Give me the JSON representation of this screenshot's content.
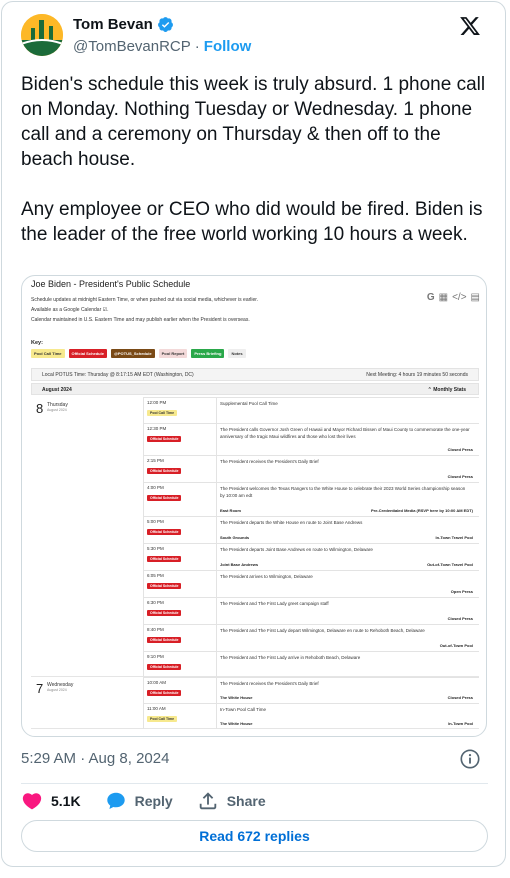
{
  "author": {
    "name": "Tom Bevan",
    "handle": "@TomBevanRCP",
    "follow_label": "Follow",
    "separator": "·",
    "verified_icon": "verified-badge-icon",
    "avatar_colors": {
      "bg": "#fdb827",
      "figure": "#1b6b3a"
    }
  },
  "tweet": {
    "text": "Biden's schedule this week is truly absurd. 1 phone call on Monday. Nothing Tuesday or Wednesday. 1 phone call and a ceremony on Thursday & then off to the beach house.\n\nAny employee or CEO who did would be fired. Biden is the leader of the free world working 10 hours a week.",
    "timestamp": "5:29 AM · Aug 8, 2024"
  },
  "media": {
    "title": "Joe Biden - President's Public Schedule",
    "notes": [
      "Schedule updates at midnight Eastern Time, or when pushed out via social media, whichever is earlier.",
      "Available as a Google Calendar ☑.",
      "Calendar maintained in U.S. Eastern Time and may publish earlier when the President is overseas."
    ],
    "tools": [
      "G",
      "▦",
      "</>",
      "▤"
    ],
    "key_label": "Key:",
    "legend": [
      {
        "label": "Pool Call Time",
        "cls": "b-pool"
      },
      {
        "label": "Official Schedule",
        "cls": "b-off"
      },
      {
        "label": "@POTUS_Schedule",
        "cls": "b-potus"
      },
      {
        "label": "Pool Report",
        "cls": "b-pr"
      },
      {
        "label": "Press Briefing",
        "cls": "b-press"
      },
      {
        "label": "Notes",
        "cls": "b-notes"
      }
    ],
    "local_time": "Local POTUS Time: Thursday @ 8:17:15 AM EDT (Washington, DC)",
    "next_meeting": "Next Meeting: 4 hours 19 minutes 50 seconds",
    "month": "August 2024",
    "stats": "⌃ Monthly Stats",
    "days": [
      {
        "num": "8",
        "name": "Thursday",
        "sub": "August 2024",
        "events": [
          {
            "time": "12:00 PM",
            "badge": "Pool Call Time",
            "cls": "b-pool",
            "desc": "Supplemental Pool Call Time",
            "loc": "",
            "access": ""
          },
          {
            "time": "12:30 PM",
            "badge": "Official Schedule",
            "cls": "b-off",
            "desc": "The President calls Governor Josh Green of Hawaii and Mayor Richard Bissen of Maui County to commemorate the one-year anniversary of the tragic Maui wildfires and those who lost their lives",
            "loc": "",
            "access": "Closed Press"
          },
          {
            "time": "2:15 PM",
            "badge": "Official Schedule",
            "cls": "b-off",
            "desc": "The President receives the President's Daily Brief",
            "loc": "",
            "access": "Closed Press"
          },
          {
            "time": "4:00 PM",
            "badge": "Official Schedule",
            "cls": "b-off",
            "desc": "The President welcomes the Texas Rangers to the White House to celebrate their 2023 World Series championship season by 10:00 am edt",
            "loc": "East Room",
            "access": "Pre-Credentialed Media (RSVP here by 10:00 AM EDT)"
          },
          {
            "time": "5:00 PM",
            "badge": "Official Schedule",
            "cls": "b-off",
            "desc": "The President departs the White House en route to Joint Base Andrews",
            "loc": "South Grounds",
            "access": "In-Town Travel Pool"
          },
          {
            "time": "5:30 PM",
            "badge": "Official Schedule",
            "cls": "b-off",
            "desc": "The President departs Joint Base Andrews en route to Wilmington, Delaware",
            "loc": "Joint Base Andrews",
            "access": "Out-of-Town Travel Pool"
          },
          {
            "time": "6:05 PM",
            "badge": "Official Schedule",
            "cls": "b-off",
            "desc": "The President arrives to Wilmington, Delaware",
            "loc": "",
            "access": "Open Press"
          },
          {
            "time": "6:30 PM",
            "badge": "Official Schedule",
            "cls": "b-off",
            "desc": "The President and The First Lady greet campaign staff",
            "loc": "",
            "access": "Closed Press"
          },
          {
            "time": "8:40 PM",
            "badge": "Official Schedule",
            "cls": "b-off",
            "desc": "The President and The First Lady depart Wilmington, Delaware en route to Rehoboth Beach, Delaware",
            "loc": "",
            "access": "Out-of-Town Pool"
          },
          {
            "time": "9:10 PM",
            "badge": "Official Schedule",
            "cls": "b-off",
            "desc": "The President and The First Lady arrive in Rehoboth Beach, Delaware",
            "loc": "",
            "access": ""
          }
        ]
      },
      {
        "num": "7",
        "name": "Wednesday",
        "sub": "August 2024",
        "events": [
          {
            "time": "10:00 AM",
            "badge": "Official Schedule",
            "cls": "b-off",
            "desc": "The President receives the President's Daily Brief",
            "loc": "The White House",
            "access": "Closed Press"
          },
          {
            "time": "11:00 AM",
            "badge": "Pool Call Time",
            "cls": "b-pool",
            "desc": "In-Town Pool Call Time",
            "loc": "The White House",
            "access": "In-Town Pool"
          }
        ]
      }
    ]
  },
  "actions": {
    "likes": "5.1K",
    "reply": "Reply",
    "share": "Share",
    "read_replies": "Read 672 replies"
  },
  "colors": {
    "link": "#1d9bf0",
    "like": "#f91880",
    "reply": "#1d9bf0"
  }
}
